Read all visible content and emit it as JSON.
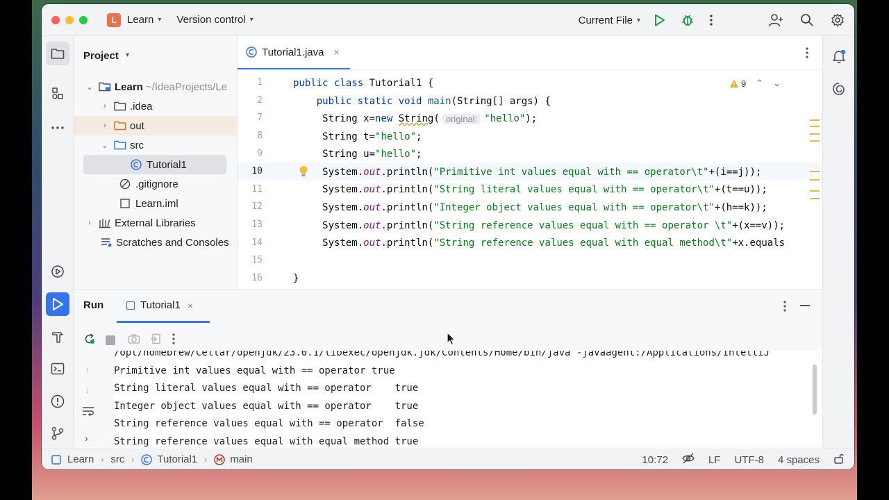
{
  "titlebar": {
    "project_badge": "L",
    "project_name": "Learn",
    "vcs_label": "Version control",
    "run_config": "Current File",
    "icons": [
      "run-icon",
      "debug-icon",
      "more-icon",
      "add-user-icon",
      "search-icon",
      "settings-icon"
    ]
  },
  "project_panel": {
    "title": "Project",
    "tree": [
      {
        "label": "Learn",
        "muted": "~/IdeaProjects/Le"
      },
      {
        "label": ".idea"
      },
      {
        "label": "out"
      },
      {
        "label": "src"
      },
      {
        "label": "Tutorial1"
      },
      {
        "label": ".gitignore"
      },
      {
        "label": "Learn.iml"
      },
      {
        "label": "External Libraries"
      },
      {
        "label": "Scratches and Consoles"
      }
    ]
  },
  "editor": {
    "tab_label": "Tutorial1.java",
    "warning_count": "9",
    "line_numbers": [
      "1",
      "2",
      "7",
      "8",
      "9",
      "10",
      "11",
      "12",
      "13",
      "14",
      "15",
      "16"
    ],
    "hint_original": "original:",
    "lines": {
      "l1a": "public class",
      "l1b": " Tutorial1 {",
      "l2a": "    public static void ",
      "l2b": "main",
      "l2c": "(String[] args) {",
      "l7a": "     String x=",
      "l7b": "new ",
      "l7c": "String",
      "l7d": "(",
      "l7e": "\"hello\"",
      "l7f": ");",
      "l8a": "     String t=",
      "l8b": "\"hello\"",
      "l8c": ";",
      "l9a": "     String u=",
      "l9b": "\"hello\"",
      "l9c": ";",
      "l10a": "     System.",
      "l10b": "out",
      "l10c": ".println(",
      "l10d": "\"Primitive int values equal with == operator\\t\"",
      "l10e": "+(i==j));",
      "l11a": "     System.",
      "l11b": "out",
      "l11c": ".println(",
      "l11d": "\"String literal values equal with == operator\\t\"",
      "l11e": "+(t==u));",
      "l12a": "     System.",
      "l12b": "out",
      "l12c": ".println(",
      "l12d": "\"Integer object values equal with == operator\\t\"",
      "l12e": "+(h==k));",
      "l13a": "     System.",
      "l13b": "out",
      "l13c": ".println(",
      "l13d": "\"String reference values equal with == operator \\t\"",
      "l13e": "+(x==v));",
      "l14a": "     System.",
      "l14b": "out",
      "l14c": ".println(",
      "l14d": "\"String reference values equal with equal method\\t\"",
      "l14e": "+x.equals",
      "l16": "}"
    }
  },
  "run_panel": {
    "title": "Run",
    "tab_label": "Tutorial1",
    "console_lines": [
      "/opt/homebrew/Cellar/openjdk/23.0.1/libexec/openjdk.jdk/Contents/Home/bin/java -javaagent:/Applications/IntelliJ",
      "Primitive int values equal with == operator true",
      "String literal values equal with == operator    true",
      "Integer object values equal with == operator    true",
      "String reference values equal with == operator  false",
      "String reference values equal with equal method true"
    ]
  },
  "statusbar": {
    "crumbs": [
      "Learn",
      "src",
      "Tutorial1",
      "main"
    ],
    "position": "10:72",
    "line_ending": "LF",
    "encoding": "UTF-8",
    "indent": "4 spaces"
  },
  "colors": {
    "accent": "#3574f0",
    "keyword": "#0033b3",
    "string": "#067d17",
    "static_field": "#871094",
    "badge": "#e8734d"
  }
}
